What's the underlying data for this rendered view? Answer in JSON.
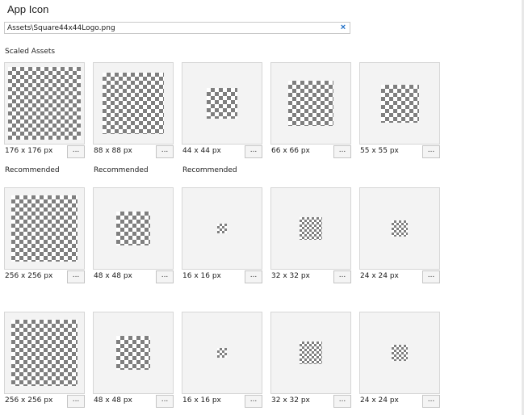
{
  "section": {
    "title": "App Icon"
  },
  "path_field": {
    "value": "Assets\\Square44x44Logo.png",
    "clear_glyph": "×"
  },
  "scaled_assets": {
    "label": "Scaled Assets"
  },
  "browse_label": "...",
  "rows": [
    {
      "cards": [
        {
          "size_label": "176 x 176 px",
          "recommended": "Recommended"
        },
        {
          "size_label": "88 x 88 px",
          "recommended": "Recommended"
        },
        {
          "size_label": "44 x 44 px",
          "recommended": "Recommended"
        },
        {
          "size_label": "66 x 66 px",
          "recommended": ""
        },
        {
          "size_label": "55 x 55 px",
          "recommended": ""
        }
      ]
    },
    {
      "cards": [
        {
          "size_label": "256 x 256 px",
          "recommended": ""
        },
        {
          "size_label": "48 x 48 px",
          "recommended": ""
        },
        {
          "size_label": "16 x 16 px",
          "recommended": ""
        },
        {
          "size_label": "32 x 32 px",
          "recommended": ""
        },
        {
          "size_label": "24 x 24 px",
          "recommended": ""
        }
      ]
    },
    {
      "cards": [
        {
          "size_label": "256 x 256 px",
          "recommended": ""
        },
        {
          "size_label": "48 x 48 px",
          "recommended": ""
        },
        {
          "size_label": "16 x 16 px",
          "recommended": ""
        },
        {
          "size_label": "32 x 32 px",
          "recommended": ""
        },
        {
          "size_label": "24 x 24 px",
          "recommended": ""
        }
      ]
    }
  ],
  "colors": {
    "accent": "#1e6fc7",
    "card_bg": "#f3f3f3",
    "checker_dark": "#7f7f7f"
  }
}
